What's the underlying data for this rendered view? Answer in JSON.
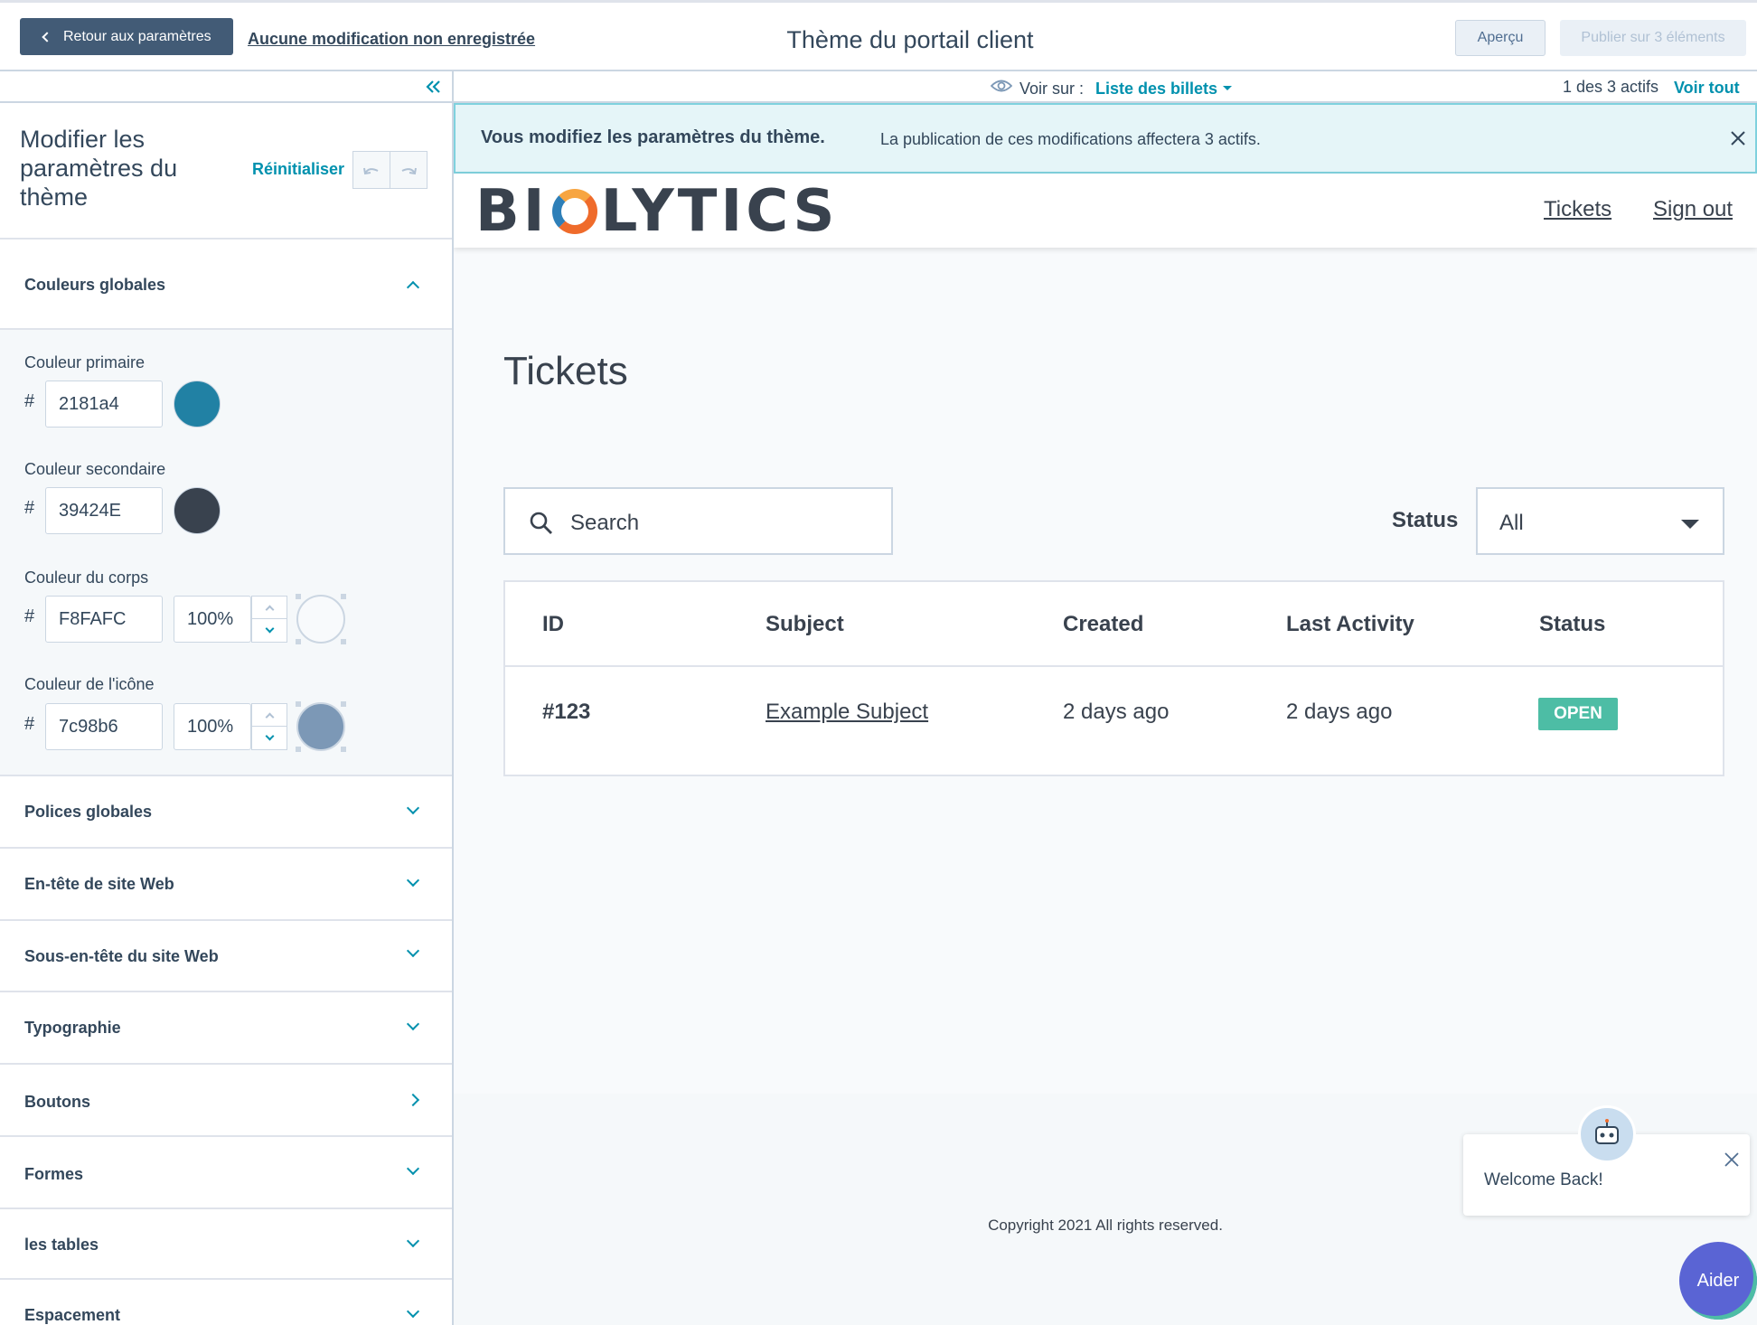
{
  "topbar": {
    "back_label": "Retour aux paramètres",
    "unsaved_label": "Aucune modification non enregistrée",
    "title": "Thème du portail client",
    "preview_label": "Aperçu",
    "publish_label": "Publier sur 3 éléments"
  },
  "subbar": {
    "view_on_label": "Voir sur :",
    "view_on_value": "Liste des billets",
    "assets_count": "1 des 3 actifs",
    "view_all_label": "Voir tout"
  },
  "sidebar": {
    "title": "Modifier les paramètres du thème",
    "reset_label": "Réinitialiser",
    "sections": {
      "global_colors": "Couleurs globales",
      "global_fonts": "Polices globales",
      "website_header": "En-tête de site Web",
      "website_subheader": "Sous-en-tête du site Web",
      "typography": "Typographie",
      "buttons": "Boutons",
      "forms": "Formes",
      "tables": "les tables",
      "spacing": "Espacement"
    },
    "colors": {
      "hash": "#",
      "primary": {
        "label": "Couleur primaire",
        "hex": "2181a4",
        "swatch": "#2181a4"
      },
      "secondary": {
        "label": "Couleur secondaire",
        "hex": "39424E",
        "swatch": "#39424e"
      },
      "body": {
        "label": "Couleur du corps",
        "hex": "F8FAFC",
        "opacity": "100%",
        "swatch": "#f8fafc"
      },
      "icon": {
        "label": "Couleur de l'icône",
        "hex": "7c98b6",
        "opacity": "100%",
        "swatch": "#7c98b6"
      }
    }
  },
  "preview": {
    "banner_strong": "Vous modifiez les paramètres du thème.",
    "banner_text": "La publication de ces modifications affectera 3 actifs.",
    "logo": {
      "left": "BI",
      "right": "LYTICS"
    },
    "nav": {
      "tickets": "Tickets",
      "sign_out": "Sign out"
    },
    "heading": "Tickets",
    "search_placeholder": "Search",
    "status_label": "Status",
    "status_value": "All",
    "table": {
      "headers": [
        "ID",
        "Subject",
        "Created",
        "Last Activity",
        "Status"
      ],
      "row": {
        "id": "#123",
        "subject": "Example Subject",
        "created": "2 days ago",
        "last_activity": "2 days ago",
        "status": "OPEN"
      }
    },
    "copyright": "Copyright 2021 All rights reserved."
  },
  "chat": {
    "message": "Welcome Back!",
    "help_label": "Aider"
  }
}
